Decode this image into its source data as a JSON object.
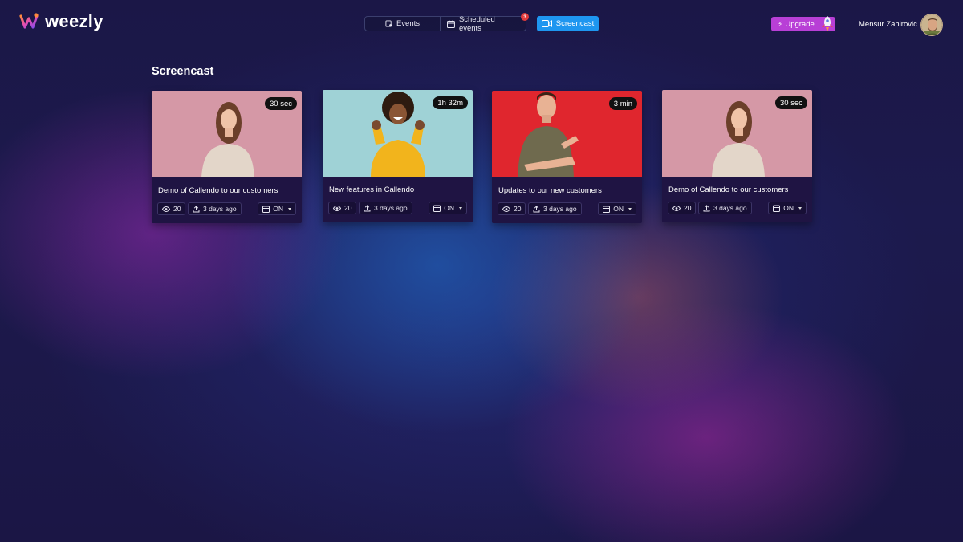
{
  "app": {
    "name": "weezly"
  },
  "nav": {
    "tabs": [
      {
        "label": "Events",
        "icon": "event-icon"
      },
      {
        "label": "Scheduled events",
        "icon": "calendar-icon",
        "badge": "3"
      },
      {
        "label": "Screencast",
        "icon": "video-camera-icon",
        "active": true
      }
    ]
  },
  "header": {
    "upgrade_label": "Upgrade",
    "user_name": "Mensur Zahirovic"
  },
  "page": {
    "title": "Screencast"
  },
  "cards": [
    {
      "duration": "30 sec",
      "title": "Demo of Callendo to our customers",
      "views": "20",
      "uploaded": "3 days ago",
      "status": "ON",
      "thumbnail": "woman-pink-background"
    },
    {
      "duration": "1h 32m",
      "title": "New features in Callendo",
      "views": "20",
      "uploaded": "3 days ago",
      "status": "ON",
      "thumbnail": "woman-yellow-sweater-blue-background"
    },
    {
      "duration": "3 min",
      "title": "Updates to our new customers",
      "views": "20",
      "uploaded": "3 days ago",
      "status": "ON",
      "thumbnail": "man-pointing-red-background"
    },
    {
      "duration": "30 sec",
      "title": "Demo of Callendo to our customers",
      "views": "20",
      "uploaded": "3 days ago",
      "status": "ON",
      "thumbnail": "woman-pink-background"
    }
  ],
  "colors": {
    "accent_blue": "#1e96f0",
    "upgrade_purple": "#b83fd6",
    "card_bg": "#1f1443",
    "badge_red": "#e23b3b"
  }
}
